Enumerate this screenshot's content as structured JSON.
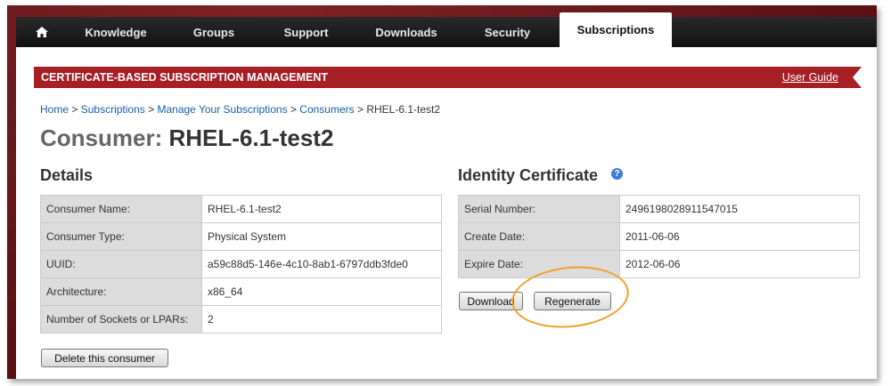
{
  "nav": {
    "home_icon": "home-icon",
    "tabs": [
      {
        "label": "Knowledge"
      },
      {
        "label": "Groups"
      },
      {
        "label": "Support"
      },
      {
        "label": "Downloads"
      },
      {
        "label": "Security"
      },
      {
        "label": "Subscriptions"
      }
    ],
    "active_tab": "Subscriptions"
  },
  "banner": {
    "title": "CERTIFICATE-BASED SUBSCRIPTION MANAGEMENT",
    "link": "User Guide"
  },
  "breadcrumb": {
    "items": [
      "Home",
      "Subscriptions",
      "Manage Your Subscriptions",
      "Consumers"
    ],
    "separator": ">",
    "current": "RHEL-6.1-test2"
  },
  "page": {
    "title_label": "Consumer:",
    "title_value": "RHEL-6.1-test2"
  },
  "details": {
    "heading": "Details",
    "rows": [
      {
        "key": "Consumer Name:",
        "value": "RHEL-6.1-test2"
      },
      {
        "key": "Consumer Type:",
        "value": "Physical System"
      },
      {
        "key": "UUID:",
        "value": "a59c88d5-146e-4c10-8ab1-6797ddb3fde0"
      },
      {
        "key": "Architecture:",
        "value": "x86_64"
      },
      {
        "key": "Number of Sockets or LPARs:",
        "value": "2"
      }
    ],
    "delete_button": "Delete this consumer"
  },
  "certificate": {
    "heading": "Identity Certificate",
    "help_icon": "?",
    "rows": [
      {
        "key": "Serial Number:",
        "value": "2496198028911547015"
      },
      {
        "key": "Create Date:",
        "value": "2011-06-06"
      },
      {
        "key": "Expire Date:",
        "value": "2012-06-06"
      }
    ],
    "download_button": "Download",
    "regenerate_button": "Regenerate"
  },
  "colors": {
    "frame": "#6b1a1e",
    "banner": "#a51f24",
    "link": "#1a5ea8",
    "highlight": "#f0a12a"
  }
}
